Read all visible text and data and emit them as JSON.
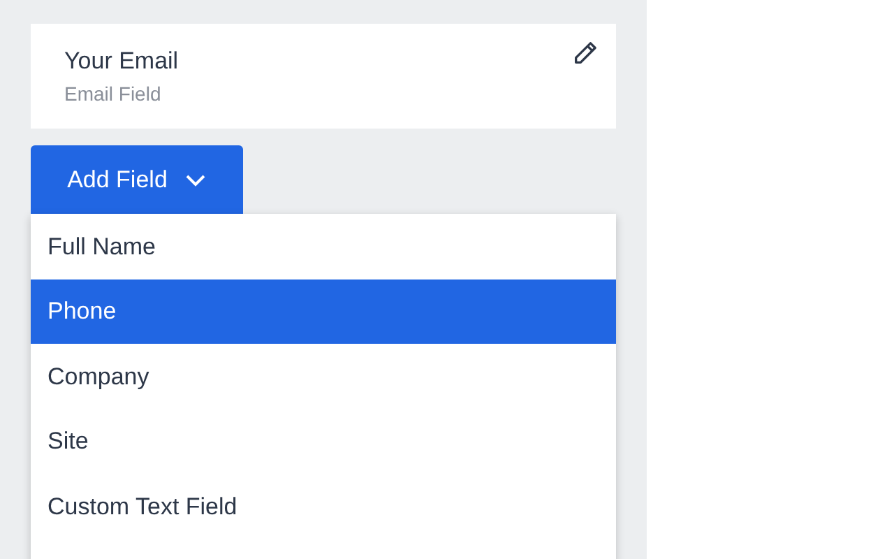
{
  "field_card": {
    "title": "Your Email",
    "subtitle": "Email Field"
  },
  "add_button": {
    "label": "Add Field",
    "expanded": true
  },
  "menu_items": [
    {
      "label": "Full Name",
      "selected": false
    },
    {
      "label": "Phone",
      "selected": true
    },
    {
      "label": "Company",
      "selected": false
    },
    {
      "label": "Site",
      "selected": false
    },
    {
      "label": "Custom Text Field",
      "selected": false
    }
  ]
}
